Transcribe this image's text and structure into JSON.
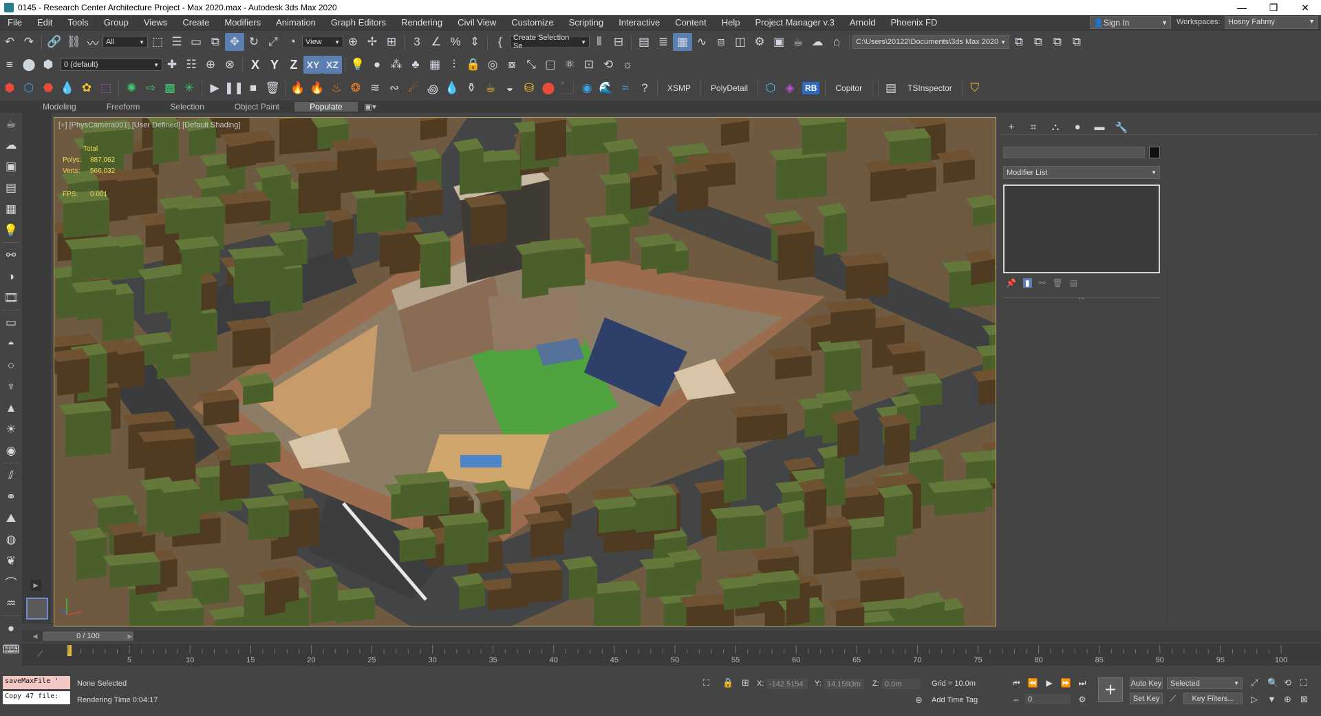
{
  "window": {
    "title": "0145 - Research Center Architecture Project - Max 2020.max - Autodesk 3ds Max 2020",
    "minimize": "—",
    "maximize": "❐",
    "close": "✕"
  },
  "menubar": {
    "items": [
      "File",
      "Edit",
      "Tools",
      "Group",
      "Views",
      "Create",
      "Modifiers",
      "Animation",
      "Graph Editors",
      "Rendering",
      "Civil View",
      "Customize",
      "Scripting",
      "Interactive",
      "Content",
      "Help",
      "Project Manager v.3",
      "Arnold",
      "Phoenix FD"
    ],
    "sign_in": "Sign In",
    "workspaces_label": "Workspaces:",
    "workspace": "Hosny Fahmy"
  },
  "toolbar1": {
    "selection_filter": "All",
    "ref_coord": "View",
    "named_selection": "Create Selection Se",
    "project_path": "C:\\Users\\20122\\Documents\\3ds Max 2020"
  },
  "toolbar2": {
    "layer": "0 (default)",
    "axis_x": "X",
    "axis_y": "Y",
    "axis_z": "Z",
    "axis_xy": "XY",
    "axis_xz": "XZ"
  },
  "toolbar3": {
    "xsmp": "XSMP",
    "polydetail": "PolyDetail",
    "rb": "RB",
    "copitor": "Copitor",
    "tsinspector": "TSInspector"
  },
  "ribbon": {
    "tabs": [
      "Modeling",
      "Freeform",
      "Selection",
      "Object Paint",
      "Populate"
    ],
    "active": "Populate"
  },
  "viewport": {
    "label": "[+] [PhysCamera001] [User Defined] [Default Shading]",
    "stats_total": "Total",
    "polys_label": "Polys:",
    "polys": "887,062",
    "verts_label": "Verts:",
    "verts": "566,032",
    "fps_label": "FPS:",
    "fps": "0.001"
  },
  "command_panel": {
    "modifier_list": "Modifier List"
  },
  "timeline": {
    "frame": "0 / 100",
    "ticks": [
      "5",
      "10",
      "15",
      "20",
      "25",
      "30",
      "35",
      "40",
      "45",
      "50",
      "55",
      "60",
      "65",
      "70",
      "75",
      "80",
      "85",
      "90",
      "95",
      "100"
    ]
  },
  "status": {
    "maxscript_line1": "saveMaxFile '",
    "maxscript_line2": "Copy 47 file:",
    "selection": "None Selected",
    "render_time": "Rendering Time  0:04:17",
    "x_label": "X:",
    "x_value": "-142.5154",
    "y_label": "Y:",
    "y_value": "14.1593m",
    "z_label": "Z:",
    "z_value": "0.0m",
    "grid": "Grid = 10.0m",
    "add_time_tag": "Add Time Tag",
    "auto_key": "Auto Key",
    "set_key": "Set Key",
    "key_mode": "Selected",
    "current_frame": "0",
    "key_filters": "Key Filters..."
  }
}
